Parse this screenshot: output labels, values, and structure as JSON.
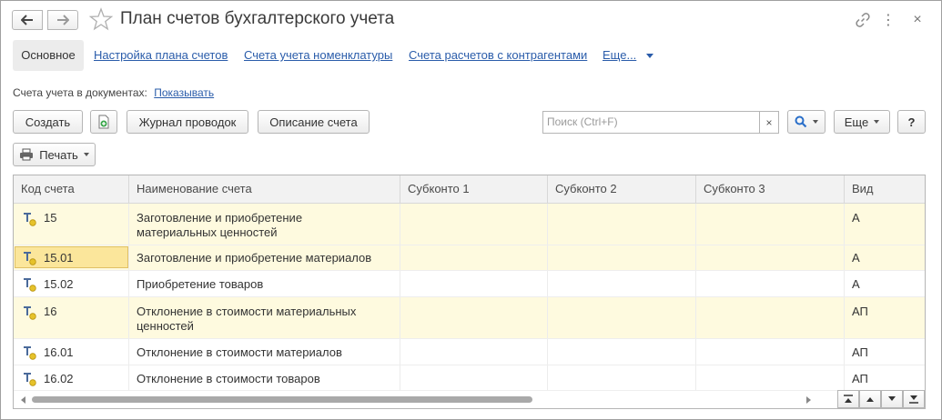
{
  "window": {
    "title": "План счетов бухгалтерского учета"
  },
  "tabs": [
    {
      "label": "Основное",
      "active": true
    },
    {
      "label": "Настройка плана счетов"
    },
    {
      "label": "Счета учета номенклатуры"
    },
    {
      "label": "Счета расчетов с контрагентами"
    },
    {
      "label": "Еще..."
    }
  ],
  "documents": {
    "label": "Счета учета в документах:",
    "link": "Показывать"
  },
  "toolbar": {
    "create_label": "Создать",
    "journal_label": "Журнал проводок",
    "description_label": "Описание счета",
    "search_placeholder": "Поиск (Ctrl+F)",
    "clear_label": "×",
    "more_label": "Еще",
    "help_label": "?",
    "print_label": "Печать"
  },
  "table": {
    "columns": [
      "Код счета",
      "Наименование счета",
      "Субконто 1",
      "Субконто 2",
      "Субконто 3",
      "Вид"
    ],
    "rows": [
      {
        "code": "15",
        "name": "Заготовление и приобретение материальных ценностей",
        "sub1": "",
        "sub2": "",
        "sub3": "",
        "kind": "А",
        "highlighted": true
      },
      {
        "code": "15.01",
        "name": "Заготовление и приобретение материалов",
        "sub1": "",
        "sub2": "",
        "sub3": "",
        "kind": "А",
        "highlighted": true,
        "selected": true
      },
      {
        "code": "15.02",
        "name": "Приобретение товаров",
        "sub1": "",
        "sub2": "",
        "sub3": "",
        "kind": "А",
        "highlighted": false
      },
      {
        "code": "16",
        "name": "Отклонение в стоимости материальных ценностей",
        "sub1": "",
        "sub2": "",
        "sub3": "",
        "kind": "АП",
        "highlighted": true
      },
      {
        "code": "16.01",
        "name": "Отклонение в стоимости материалов",
        "sub1": "",
        "sub2": "",
        "sub3": "",
        "kind": "АП",
        "highlighted": false
      },
      {
        "code": "16.02",
        "name": "Отклонение в стоимости товаров",
        "sub1": "",
        "sub2": "",
        "sub3": "",
        "kind": "АП",
        "highlighted": false
      }
    ]
  },
  "colors": {
    "link": "#2a5caa",
    "row_highlight": "#fefadf",
    "selected_cell": "#fbe69b",
    "account_icon_dot": "#e6c22a"
  }
}
